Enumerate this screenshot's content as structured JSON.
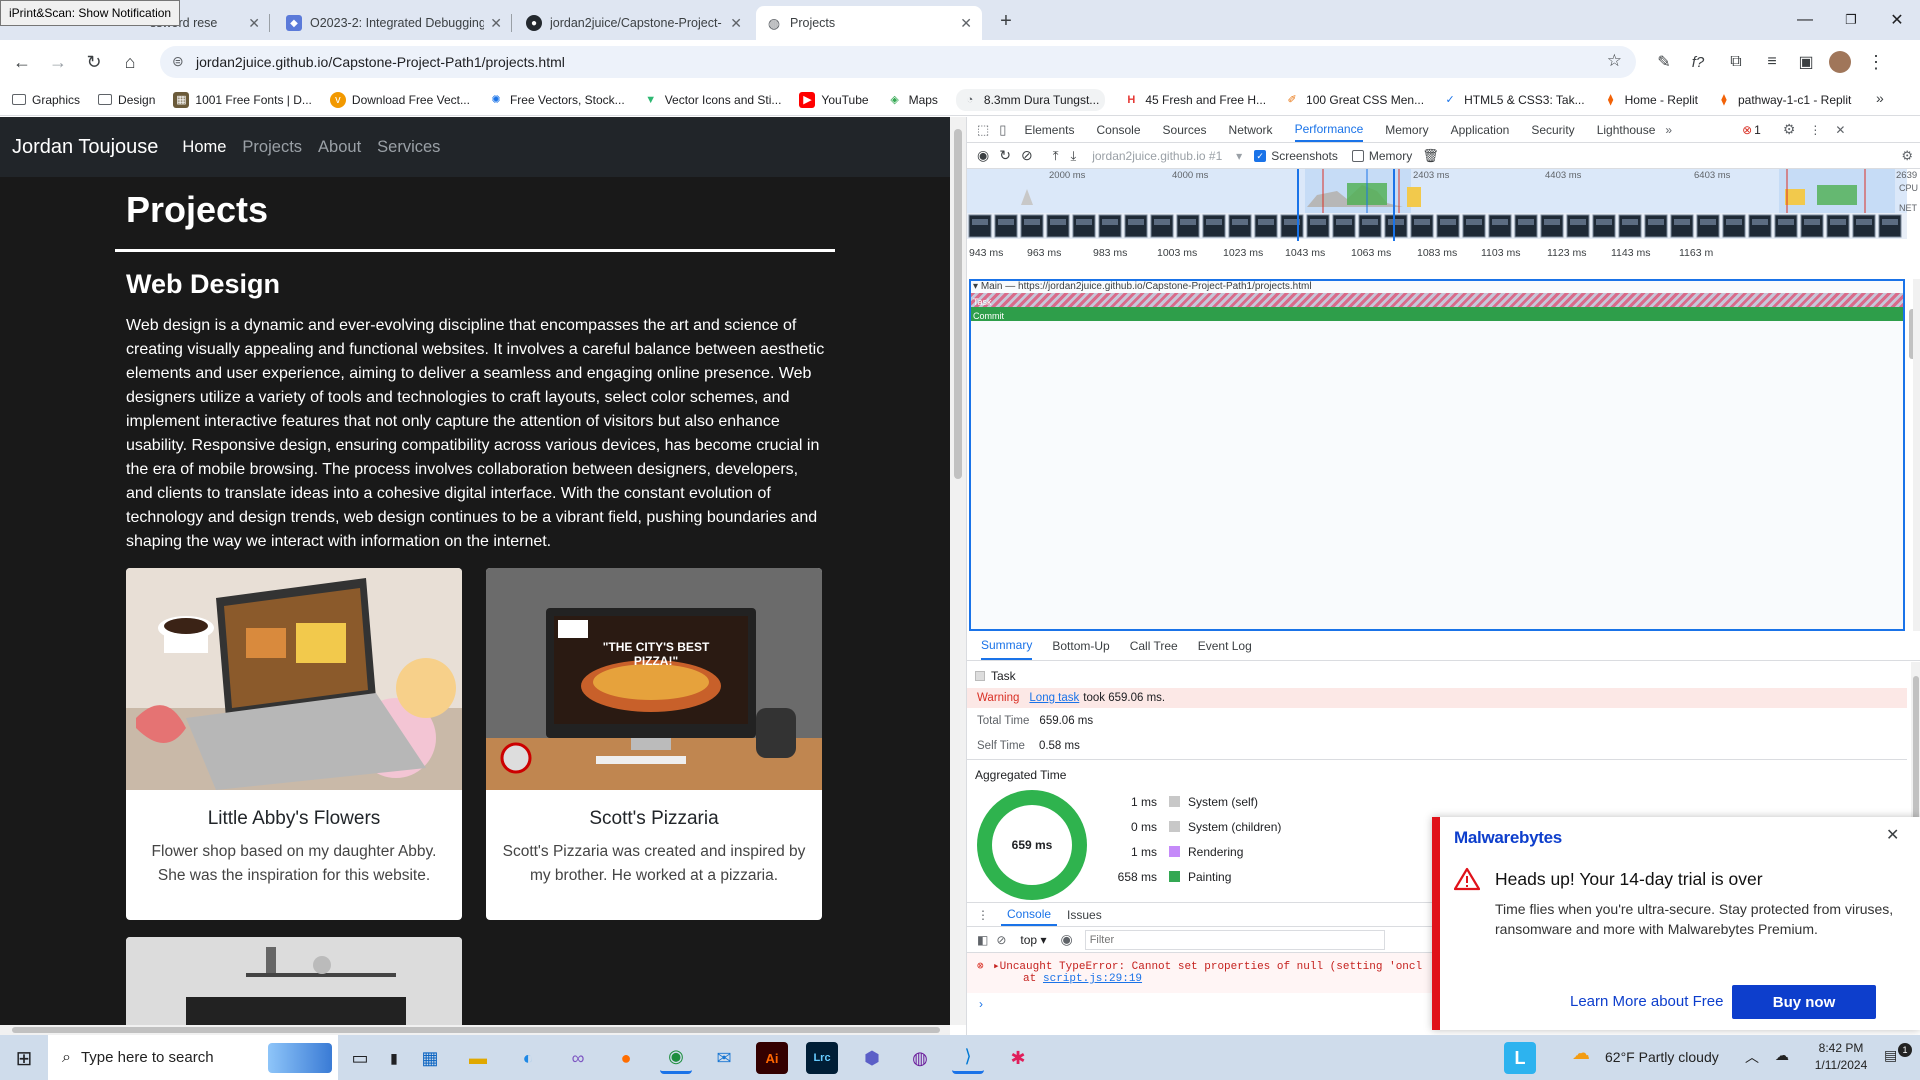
{
  "tooltip": "iPrint&Scan: Show Notification",
  "tabs": [
    {
      "title": "ssword rese",
      "fav": "key-icon"
    },
    {
      "title": "O2023-2: Integrated Debugging",
      "fav": "course-icon"
    },
    {
      "title": "jordan2juice/Capstone-Project-",
      "fav": "github-icon"
    },
    {
      "title": "Projects",
      "fav": "globe-icon"
    }
  ],
  "toolbar": {
    "url": "jordan2juice.github.io/Capstone-Project-Path1/projects.html"
  },
  "bookmarks": [
    "Graphics",
    "Design",
    "1001 Free Fonts | D...",
    "Download Free Vect...",
    "Free Vectors, Stock...",
    "Vector Icons and Sti...",
    "YouTube",
    "Maps",
    "8.3mm Dura Tungst...",
    "45 Fresh and Free H...",
    "100 Great CSS Men...",
    "HTML5 & CSS3: Tak...",
    "Home - Replit",
    "pathway-1-c1 - Replit"
  ],
  "site": {
    "brand": "Jordan Toujouse",
    "nav": [
      "Home",
      "Projects",
      "About",
      "Services"
    ],
    "title": "Projects",
    "section_title": "Web Design",
    "section_body": "Web design is a dynamic and ever-evolving discipline that encompasses the art and science of creating visually appealing and functional websites. It involves a careful balance between aesthetic elements and user experience, aiming to deliver a seamless and engaging online presence. Web designers utilize a variety of tools and technologies to craft layouts, select color schemes, and implement interactive features that not only capture the attention of visitors but also enhance usability. Responsive design, ensuring compatibility across various devices, has become crucial in the era of mobile browsing. The process involves collaboration between designers, developers, and clients to translate ideas into a cohesive digital interface. With the constant evolution of technology and design trends, web design continues to be a vibrant field, pushing boundaries and shaping the way we interact with information on the internet.",
    "cards": [
      {
        "title": "Little Abby's Flowers",
        "text": "Flower shop based on my daughter Abby. She was the inspiration for this website."
      },
      {
        "title": "Scott's Pizzaria",
        "text": "Scott's Pizzaria was created and inspired by my brother. He worked at a pizzaria.",
        "img_text": "\"THE CITY'S BEST PIZZA!\""
      }
    ]
  },
  "devtools": {
    "tabs": [
      "Elements",
      "Console",
      "Sources",
      "Network",
      "Performance",
      "Memory",
      "Application",
      "Security",
      "Lighthouse"
    ],
    "errors": "1",
    "profile": "jordan2juice.github.io #1",
    "screenshots_label": "Screenshots",
    "memory_label": "Memory",
    "overview_ticks": [
      "2000 ms",
      "4000 ms",
      "2403 ms",
      "4403 ms",
      "6403 ms",
      "2639"
    ],
    "overview_side": [
      "CPU",
      "NET"
    ],
    "ruler": [
      "943 ms",
      "963 ms",
      "983 ms",
      "1003 ms",
      "1023 ms",
      "1043 ms",
      "1063 ms",
      "1083 ms",
      "1103 ms",
      "1123 ms",
      "1143 ms",
      "1163 m"
    ],
    "main_label": "Main — https://jordan2juice.github.io/Capstone-Project-Path1/projects.html",
    "task_label": "Task",
    "commit_label": "Commit",
    "bottom_tabs": [
      "Summary",
      "Bottom-Up",
      "Call Tree",
      "Event Log"
    ],
    "summary": {
      "task": "Task",
      "warning_label": "Warning",
      "warning_link": "Long task",
      "warning_text": "took 659.06 ms.",
      "total_label": "Total Time",
      "total_value": "659.06 ms",
      "self_label": "Self Time",
      "self_value": "0.58 ms",
      "agg_title": "Aggregated Time",
      "donut": "659 ms",
      "rows": [
        {
          "v": "1 ms",
          "l": "System (self)",
          "c": "#c8c8c8"
        },
        {
          "v": "0 ms",
          "l": "System (children)",
          "c": "#c8c8c8"
        },
        {
          "v": "1 ms",
          "l": "Rendering",
          "c": "#c58af9"
        },
        {
          "v": "658 ms",
          "l": "Painting",
          "c": "#34a853"
        }
      ]
    },
    "drawer": {
      "tabs": [
        "Console",
        "Issues"
      ],
      "context": "top",
      "filter_placeholder": "Filter",
      "error": "Uncaught TypeError: Cannot set properties of null (setting 'oncl",
      "error_at": "at",
      "error_link": "script.js:29:19"
    }
  },
  "malwarebytes": {
    "brand": "Malwarebytes",
    "heading": "Heads up! Your 14-day trial is over",
    "body": "Time flies when you're ultra-secure. Stay protected from viruses, ransomware and more with Malwarebytes Premium.",
    "learn": "Learn More about Free",
    "buy": "Buy now"
  },
  "taskbar": {
    "search": "Type here to search",
    "weather": "62°F  Partly cloudy",
    "time": "8:42 PM",
    "date": "1/11/2024",
    "notif": "1"
  }
}
